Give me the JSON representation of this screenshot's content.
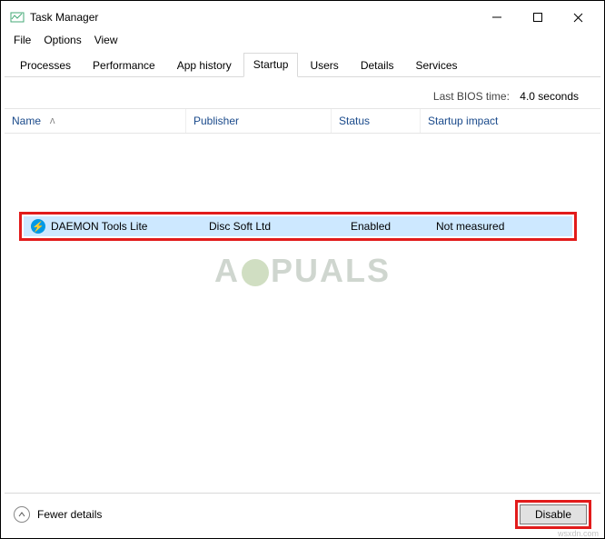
{
  "window": {
    "title": "Task Manager"
  },
  "menu": {
    "file": "File",
    "options": "Options",
    "view": "View"
  },
  "tabs": {
    "processes": "Processes",
    "performance": "Performance",
    "app_history": "App history",
    "startup": "Startup",
    "users": "Users",
    "details": "Details",
    "services": "Services"
  },
  "bios": {
    "label": "Last BIOS time:",
    "value": "4.0 seconds"
  },
  "columns": {
    "name": "Name",
    "publisher": "Publisher",
    "status": "Status",
    "impact": "Startup impact"
  },
  "rows": [
    {
      "name": "DAEMON Tools Lite",
      "publisher": "Disc Soft Ltd",
      "status": "Enabled",
      "impact": "Not measured"
    }
  ],
  "footer": {
    "fewer": "Fewer details",
    "disable": "Disable"
  },
  "watermark": {
    "part1": "A",
    "part2": "PUALS"
  },
  "source_label": "wsxdn.com"
}
